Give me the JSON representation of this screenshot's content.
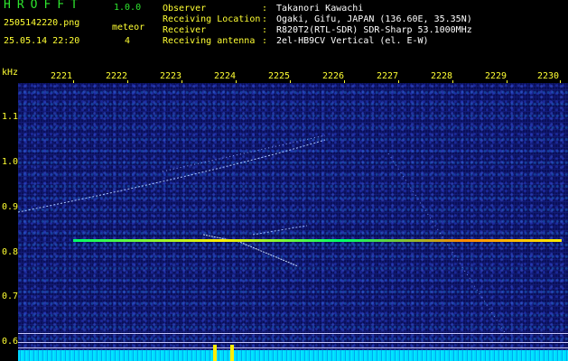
{
  "header": {
    "app_title": "HROFFT",
    "app_version": "1.0.0",
    "file_name": "2505142220.png",
    "meteor_label": "meteor",
    "date_time": "25.05.14 22:20",
    "meteor_count": "4",
    "info": [
      {
        "label": "Observer",
        "value": "Takanori Kawachi"
      },
      {
        "label": "Receiving Location",
        "value": "Ogaki, Gifu, JAPAN (136.60E, 35.35N)"
      },
      {
        "label": "Receiver",
        "value": "R820T2(RTL-SDR) SDR-Sharp 53.1000MHz"
      },
      {
        "label": "Receiving antenna",
        "value": "2el-HB9CV Vertical (el. E-W)"
      }
    ],
    "separator": ":"
  },
  "axes": {
    "unit": "kHz",
    "x_ticks": [
      "2221",
      "2222",
      "2223",
      "2224",
      "2225",
      "2226",
      "2227",
      "2228",
      "2229",
      "2230"
    ],
    "y_ticks": [
      "1.1",
      "1.0",
      "0.9",
      "0.8",
      "0.7",
      "0.6"
    ]
  },
  "colors": {
    "header_green": "#2ee62e",
    "header_yellow": "#ffff33",
    "spectrogram_bg": "#0a0f5a",
    "trail": "#aac8ff"
  }
}
